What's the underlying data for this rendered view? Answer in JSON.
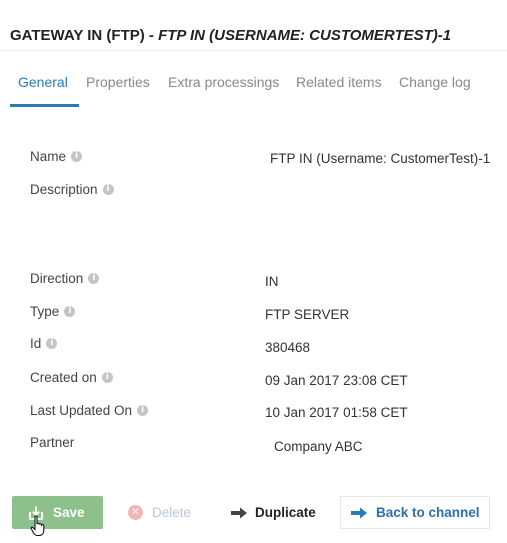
{
  "header": {
    "title_main": "GATEWAY IN (FTP)",
    "title_separator": " - ",
    "title_sub": "FTP IN (USERNAME: CUSTOMERTEST)-1"
  },
  "tabs": [
    {
      "label": "General",
      "active": true
    },
    {
      "label": "Properties",
      "active": false
    },
    {
      "label": "Extra processings",
      "active": false
    },
    {
      "label": "Related items",
      "active": false
    },
    {
      "label": "Change log",
      "active": false
    }
  ],
  "fields": {
    "name": {
      "label": "Name",
      "value": "FTP IN (Username: CustomerTest)-1"
    },
    "description": {
      "label": "Description",
      "value": ""
    },
    "direction": {
      "label": "Direction",
      "value": "IN"
    },
    "type": {
      "label": "Type",
      "value": "FTP SERVER"
    },
    "id": {
      "label": "Id",
      "value": "380468"
    },
    "created_on": {
      "label": "Created on",
      "value": "09 Jan 2017 23:08 CET"
    },
    "last_updated_on": {
      "label": "Last Updated On",
      "value": "10 Jan 2017 01:58 CET"
    },
    "partner": {
      "label": "Partner",
      "value": "Company ABC"
    }
  },
  "info_glyph": "i",
  "actions": {
    "save_label": "Save",
    "delete_label": "Delete",
    "duplicate_label": "Duplicate",
    "back_label": "Back to channel"
  },
  "colors": {
    "accent": "#2a7ab8",
    "save_bg": "#8dc08b",
    "delete_disabled": "#b9c8d8",
    "back_text": "#2a6fb0"
  },
  "icons": {
    "save": "save-download-icon",
    "delete": "close-circle-icon",
    "duplicate": "arrow-right-icon",
    "back": "arrow-right-icon",
    "info": "info-icon"
  }
}
